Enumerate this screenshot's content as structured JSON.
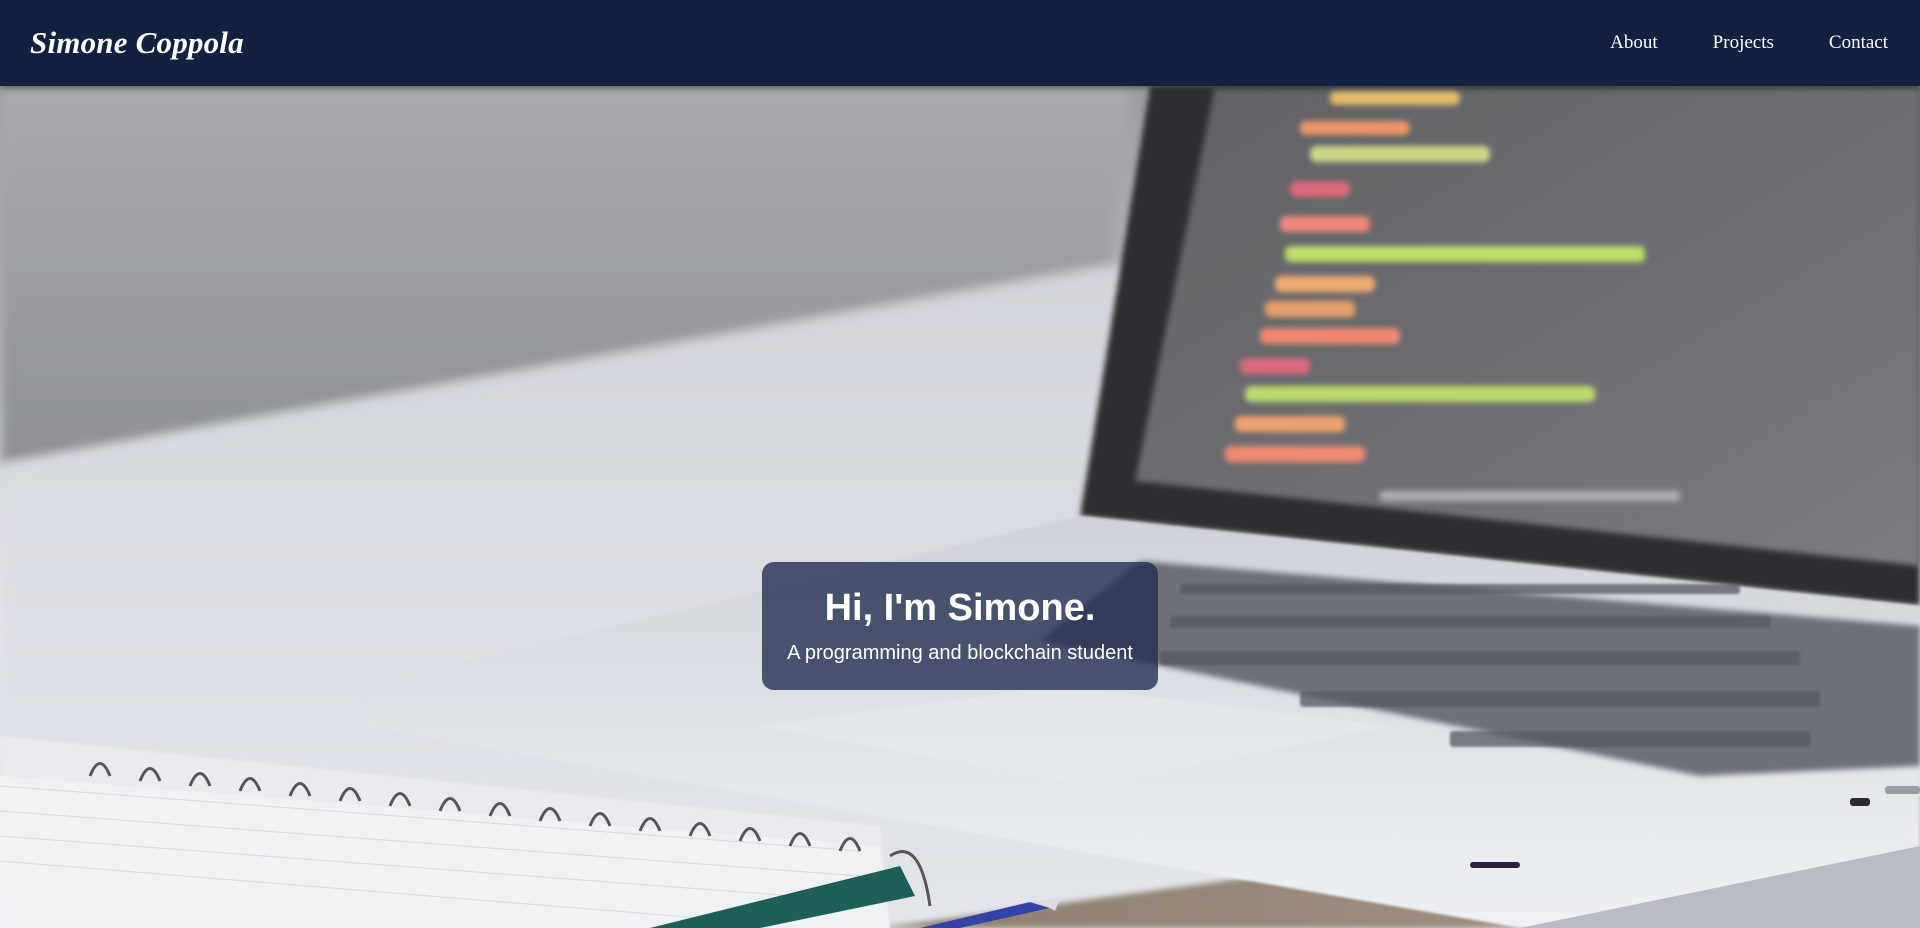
{
  "navbar": {
    "brand": "Simone Coppola",
    "links": [
      {
        "label": "About"
      },
      {
        "label": "Projects"
      },
      {
        "label": "Contact"
      }
    ],
    "background_color": "#132140"
  },
  "hero": {
    "title": "Hi, I'm Simone.",
    "subtitle": "A programming and blockchain student",
    "background_description_icon": "laptop-notebook-photo"
  }
}
